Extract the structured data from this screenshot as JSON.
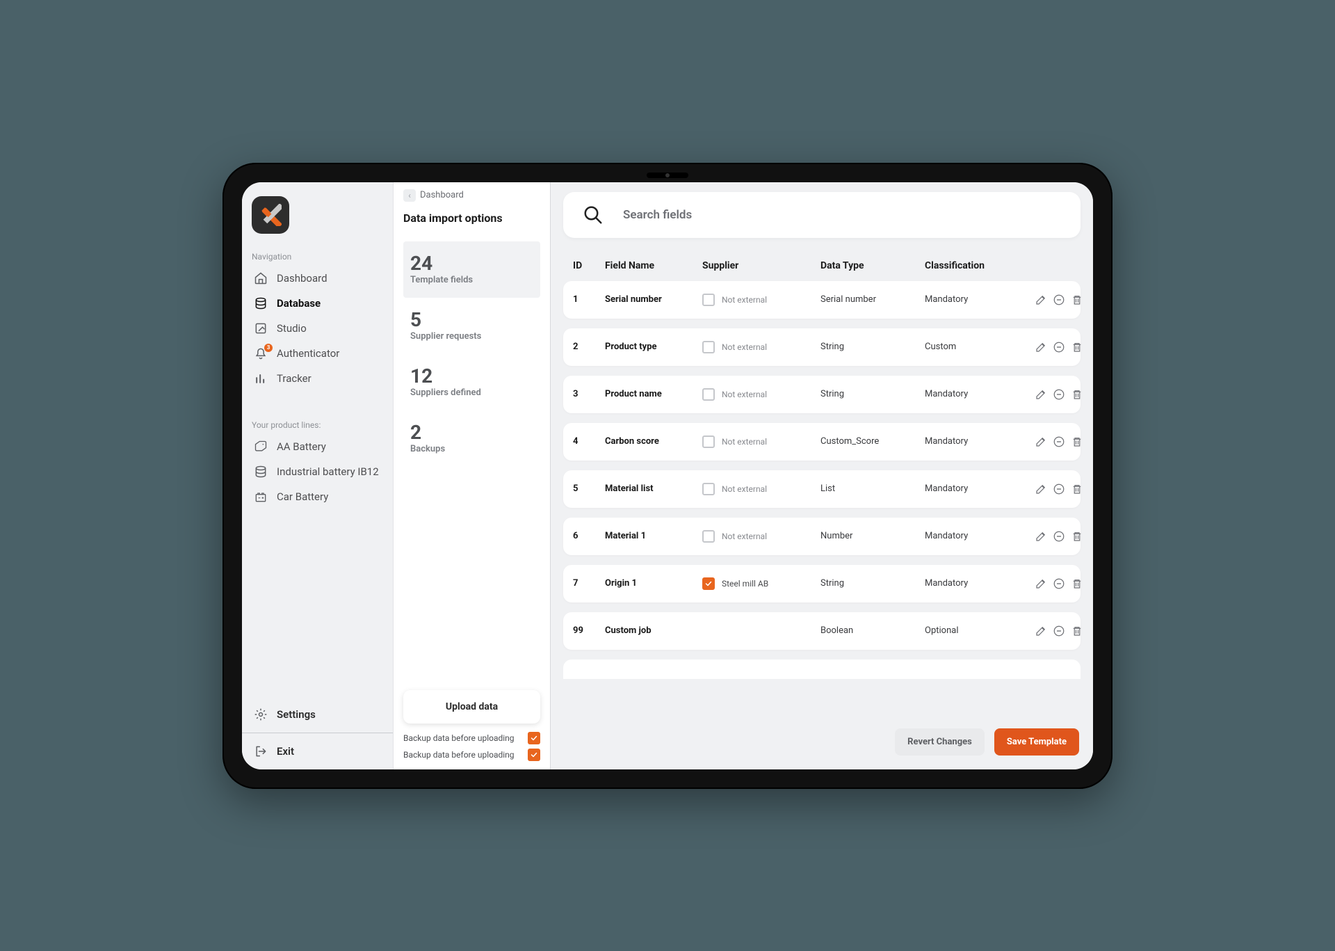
{
  "sidebar": {
    "nav_label": "Navigation",
    "items": [
      {
        "icon": "home",
        "label": "Dashboard"
      },
      {
        "icon": "database",
        "label": "Database"
      },
      {
        "icon": "studio",
        "label": "Studio"
      },
      {
        "icon": "bell",
        "label": "Authenticator",
        "badge": "3"
      },
      {
        "icon": "tracker",
        "label": "Tracker"
      }
    ],
    "products_label": "Your product lines:",
    "products": [
      {
        "icon": "tag",
        "label": "AA Battery"
      },
      {
        "icon": "database",
        "label": "Industrial battery IB12"
      },
      {
        "icon": "car-battery",
        "label": "Car Battery"
      }
    ],
    "settings_label": "Settings",
    "exit_label": "Exit"
  },
  "mid": {
    "breadcrumb": "Dashboard",
    "title": "Data import options",
    "stats": [
      {
        "value": "24",
        "label": "Template fields"
      },
      {
        "value": "5",
        "label": "Supplier requests"
      },
      {
        "value": "12",
        "label": "Suppliers defined"
      },
      {
        "value": "2",
        "label": "Backups"
      }
    ],
    "upload_label": "Upload data",
    "check1": "Backup data before uploading",
    "check2": "Backup data before uploading"
  },
  "main": {
    "search_placeholder": "Search fields",
    "columns": {
      "id": "ID",
      "field_name": "Field Name",
      "supplier": "Supplier",
      "data_type": "Data Type",
      "classification": "Classification"
    },
    "rows": [
      {
        "id": "1",
        "name": "Serial number",
        "supplier_checked": false,
        "supplier_text": "Not external",
        "data_type": "Serial number",
        "classification": "Mandatory"
      },
      {
        "id": "2",
        "name": "Product type",
        "supplier_checked": false,
        "supplier_text": "Not external",
        "data_type": "String",
        "classification": "Custom"
      },
      {
        "id": "3",
        "name": "Product name",
        "supplier_checked": false,
        "supplier_text": "Not external",
        "data_type": "String",
        "classification": "Mandatory"
      },
      {
        "id": "4",
        "name": "Carbon score",
        "supplier_checked": false,
        "supplier_text": "Not external",
        "data_type": "Custom_Score",
        "classification": "Mandatory"
      },
      {
        "id": "5",
        "name": "Material list",
        "supplier_checked": false,
        "supplier_text": "Not external",
        "data_type": "List",
        "classification": "Mandatory"
      },
      {
        "id": "6",
        "name": "Material 1",
        "supplier_checked": false,
        "supplier_text": "Not external",
        "data_type": "Number",
        "classification": "Mandatory"
      },
      {
        "id": "7",
        "name": "Origin 1",
        "supplier_checked": true,
        "supplier_text": "Steel mill AB",
        "data_type": "String",
        "classification": "Mandatory"
      },
      {
        "id": "99",
        "name": "Custom job",
        "supplier_checked": null,
        "supplier_text": "",
        "data_type": "Boolean",
        "classification": "Optional"
      }
    ],
    "revert_label": "Revert Changes",
    "save_label": "Save Template"
  },
  "colors": {
    "accent": "#e8651e"
  }
}
